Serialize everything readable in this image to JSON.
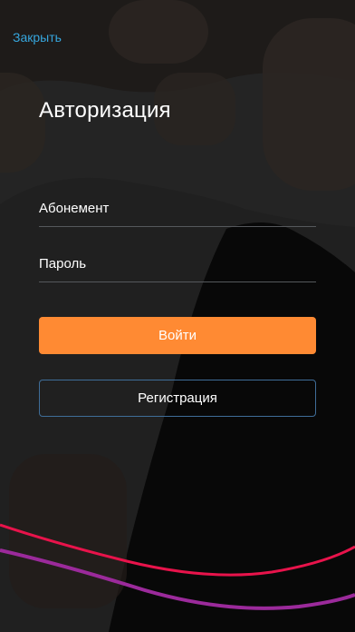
{
  "header": {
    "close_label": "Закрыть"
  },
  "auth": {
    "title": "Авторизация",
    "subscription_placeholder": "Абонемент",
    "password_placeholder": "Пароль",
    "login_label": "Войти",
    "register_label": "Регистрация"
  },
  "colors": {
    "accent": "#ff8a33",
    "link": "#36a6dd",
    "secondary_border": "#3f6d98",
    "wave_red": "#e8134b",
    "wave_purple": "#9b2a9b"
  }
}
